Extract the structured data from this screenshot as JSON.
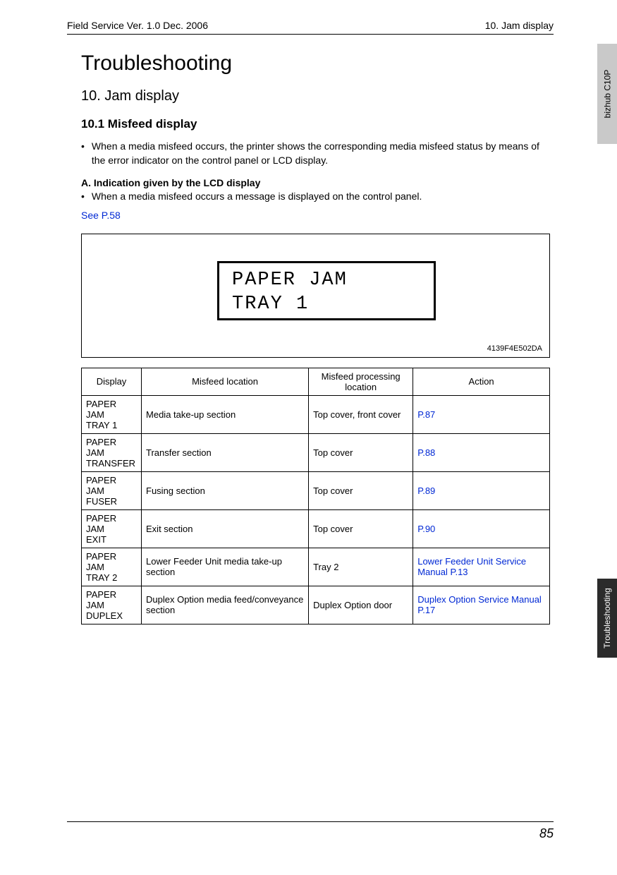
{
  "header": {
    "left": "Field Service Ver. 1.0 Dec. 2006",
    "right": "10. Jam display"
  },
  "tabs": {
    "light": "bizhub C10P",
    "dark": "Troubleshooting"
  },
  "title": "Troubleshooting",
  "section_number": "10.  Jam display",
  "subsection": "10.1   Misfeed display",
  "bullet1": "When a media misfeed occurs, the printer shows the corresponding media misfeed status by means of the error indicator on the control panel or LCD display.",
  "sub_a": "A.   Indication given by the LCD display",
  "bullet2": "When a media misfeed occurs a message is displayed on the control panel.",
  "see_link": "See P.58",
  "lcd": {
    "line1": "PAPER JAM",
    "line2": "TRAY 1"
  },
  "figure_id": "4139F4E502DA",
  "table": {
    "headers": {
      "c1": "Display",
      "c2": "Misfeed location",
      "c3": "Misfeed processing location",
      "c4": "Action"
    },
    "rows": [
      {
        "d1": "PAPER JAM",
        "d1b": "TRAY 1",
        "c2": "Media take-up section",
        "c3": "Top cover, front cover",
        "c4": "P.87"
      },
      {
        "d1": "PAPER JAM",
        "d1b": "TRANSFER",
        "c2": "Transfer section",
        "c3": "Top cover",
        "c4": "P.88"
      },
      {
        "d1": "PAPER JAM",
        "d1b": "FUSER",
        "c2": "Fusing section",
        "c3": "Top cover",
        "c4": "P.89"
      },
      {
        "d1": "PAPER JAM",
        "d1b": "EXIT",
        "c2": "Exit section",
        "c3": "Top cover",
        "c4": "P.90"
      },
      {
        "d1": "PAPER JAM",
        "d1b": "TRAY 2",
        "c2": "Lower Feeder Unit media take-up section",
        "c3": "Tray 2",
        "c4": "Lower Feeder Unit Service Manual P.13"
      },
      {
        "d1": "PAPER JAM",
        "d1b": "DUPLEX",
        "c2": "Duplex Option media feed/conveyance section",
        "c3": "Duplex Option door",
        "c4": "Duplex Option Service Manual P.17"
      }
    ]
  },
  "page_number": "85"
}
